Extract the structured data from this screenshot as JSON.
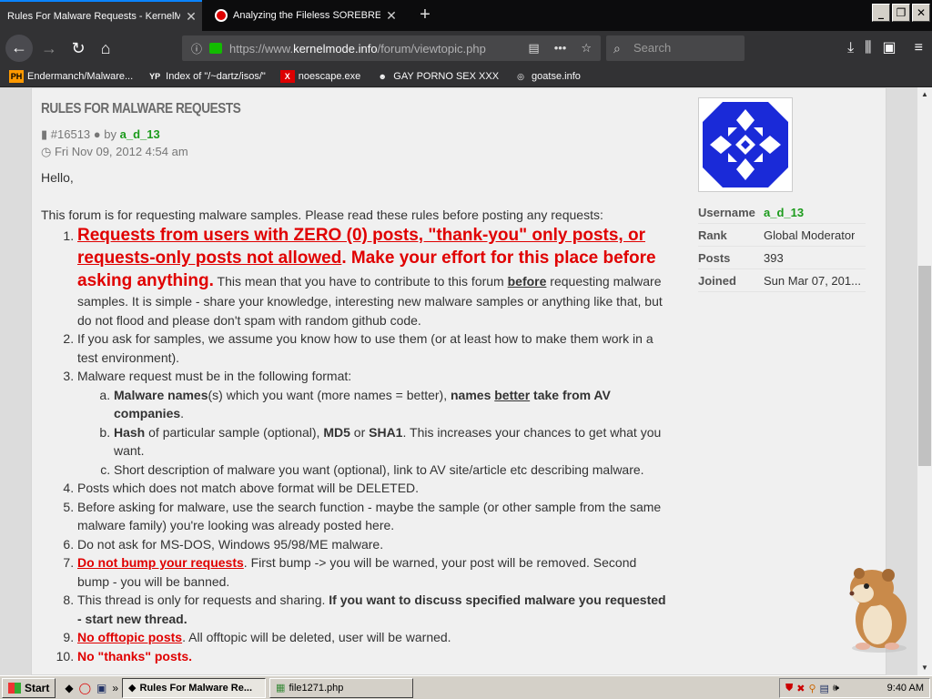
{
  "browser": {
    "tabs": [
      {
        "title": "Rules For Malware Requests - KernelMode",
        "active": true
      },
      {
        "title": "Analyzing the Fileless SOREBRECT",
        "active": false
      }
    ],
    "url_prefix": "https://www.",
    "url_domain": "kernelmode.info",
    "url_path": "/forum/viewtopic.php",
    "search_placeholder": "Search",
    "bookmarks": [
      {
        "icon": "PH",
        "label": "Endermanch/Malware..."
      },
      {
        "icon": "YP",
        "label": "Index of \"/~dartz/isos/\""
      },
      {
        "icon": "X",
        "label": "noescape.exe"
      },
      {
        "icon": "mask",
        "label": "GAY PORNO SEX XXX"
      },
      {
        "icon": "globe",
        "label": "goatse.info"
      }
    ]
  },
  "post": {
    "title": "RULES FOR MALWARE REQUESTS",
    "id": "#16513",
    "by": "by",
    "author": "a_d_13",
    "date": "Fri Nov 09, 2012 4:54 am",
    "greeting": "Hello,",
    "intro": "This forum is for requesting malware samples. Please read these rules before posting any requests:",
    "rule1_red_underlined": "Requests from users with ZERO (0) posts, \"thank-you\" only posts, or requests-only posts not allowed",
    "rule1_red_rest": ". Make your effort for this place before asking anything.",
    "rule1_text_a": " This mean that you have to contribute to this forum ",
    "rule1_before": "before",
    "rule1_text_b": " requesting malware samples. It is simple - share your knowledge, interesting new malware samples or anything like that, but do not flood and please don't spam with random github code.",
    "rule2": "If you ask for samples, we assume you know how to use them (or at least how to make them work in a test environment).",
    "rule3": "Malware request must be in the following format:",
    "rule3a_b1": "Malware names",
    "rule3a_t1": "(s) which you want (more names = better), ",
    "rule3a_b2": "names ",
    "rule3a_bu": "better",
    "rule3a_b3": " take from AV companies",
    "rule3a_t2": ".",
    "rule3b_b1": "Hash",
    "rule3b_t1": " of particular sample (optional), ",
    "rule3b_b2": "MD5",
    "rule3b_t2": " or ",
    "rule3b_b3": "SHA1",
    "rule3b_t3": ". This increases your chances to get what you want.",
    "rule3c": "Short description of malware you want (optional), link to AV site/article etc describing malware.",
    "rule4": "Posts which does not match above format will be DELETED.",
    "rule5": "Before asking for malware, use the search function - maybe the sample (or other sample from the same malware family) you're looking was already posted here.",
    "rule6": "Do not ask for MS-DOS, Windows 95/98/ME malware.",
    "rule7_red": "Do not bump your requests",
    "rule7_text": ". First bump -> you will be warned, your post will be removed. Second bump - you will be banned.",
    "rule8_text": "This thread is only for requests and sharing. ",
    "rule8_bold": "If you want to discuss specified malware you requested - start new thread.",
    "rule9_red": "No offtopic posts",
    "rule9_text": ". All offtopic will be deleted, user will be warned.",
    "rule10_red": "No \"thanks\" posts."
  },
  "profile": {
    "username_label": "Username",
    "username": "a_d_13",
    "rank_label": "Rank",
    "rank": "Global Moderator",
    "posts_label": "Posts",
    "posts": "393",
    "joined_label": "Joined",
    "joined": "Sun Mar 07, 201..."
  },
  "taskbar": {
    "start": "Start",
    "items": [
      {
        "label": "Rules For Malware Re...",
        "active": true
      },
      {
        "label": "file1271.php",
        "active": false
      }
    ],
    "clock": "9:40 AM"
  },
  "colors": {
    "accent": "#0a84ff",
    "warning_red": "#e00000",
    "username_green": "#1c9b1c"
  }
}
